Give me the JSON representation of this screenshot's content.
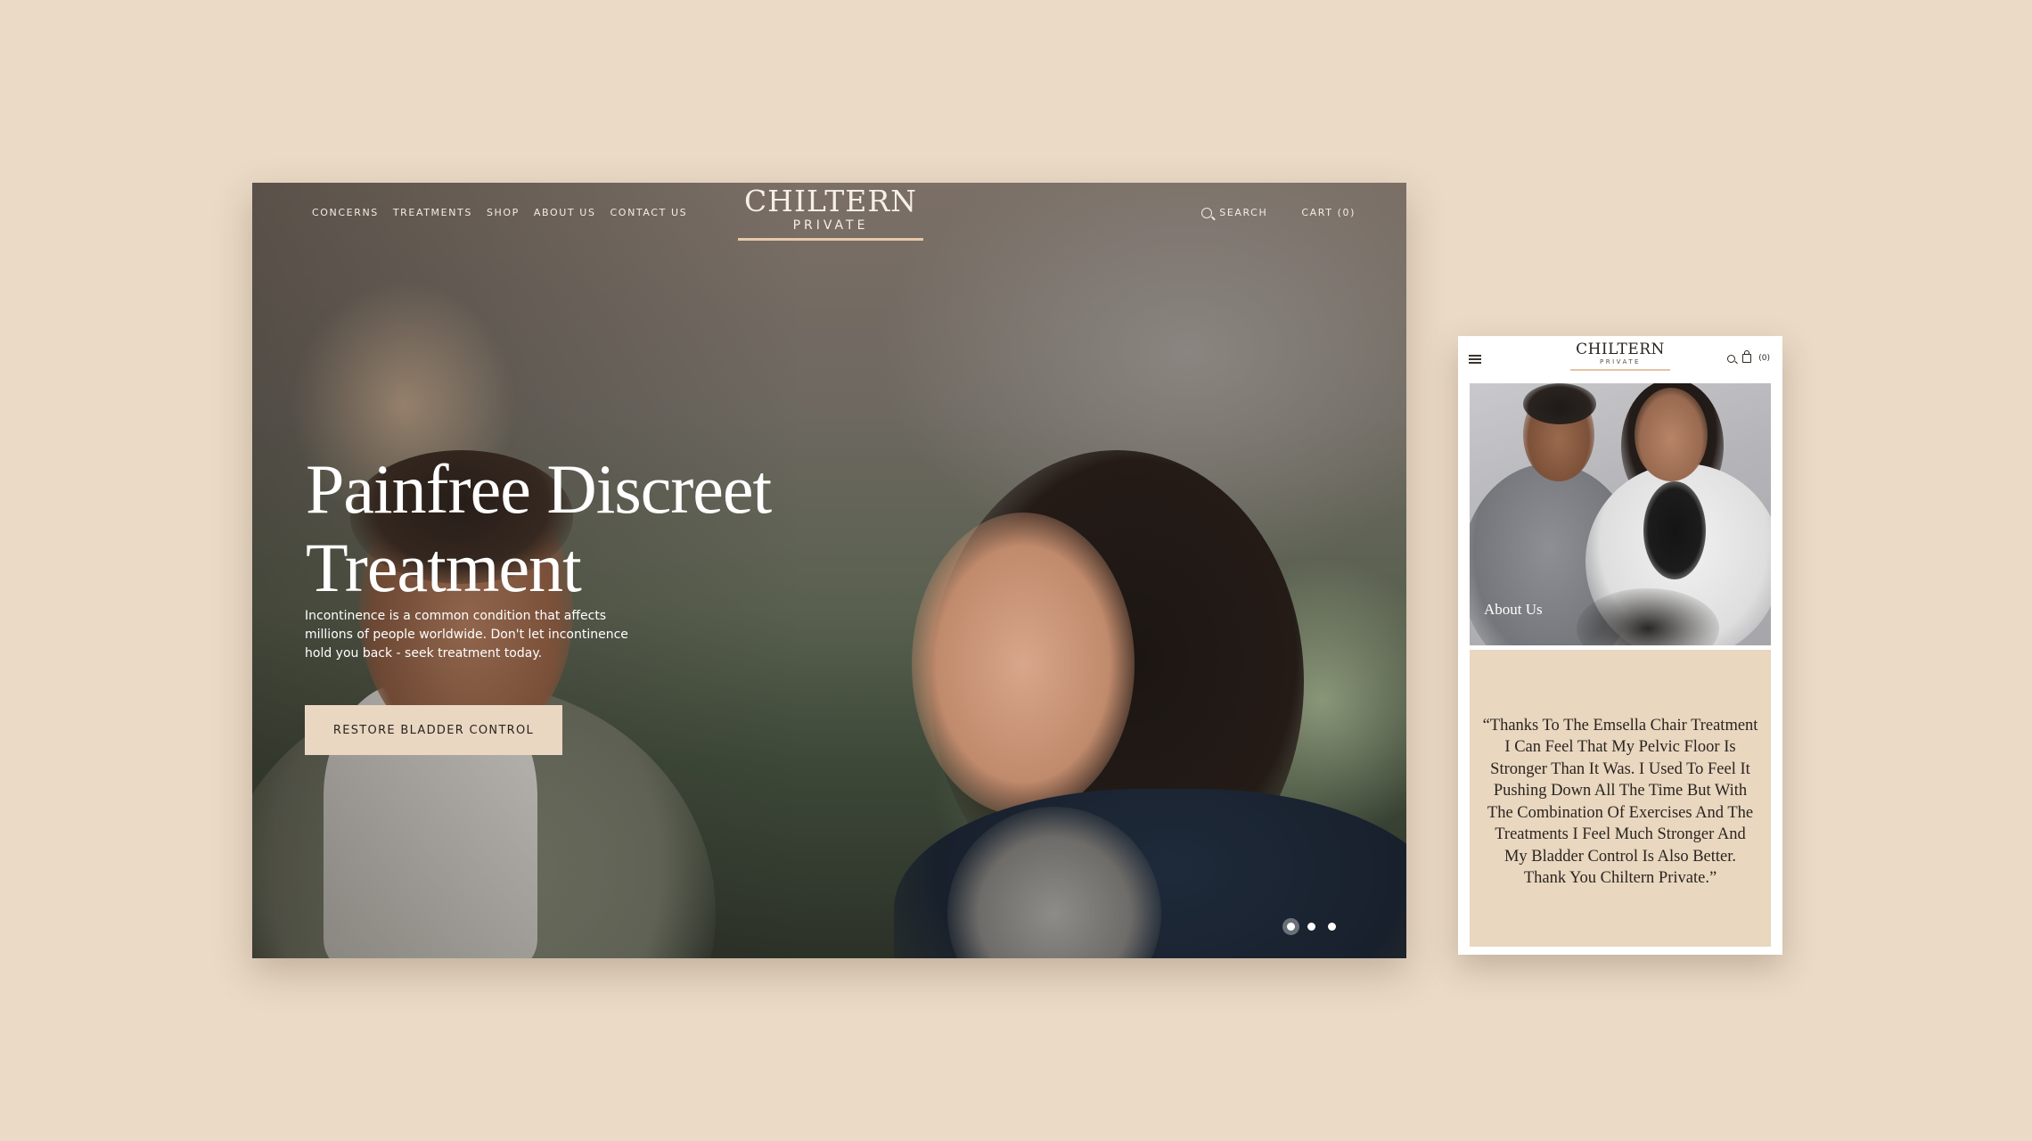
{
  "desktop": {
    "nav": {
      "links": [
        "CONCERNS",
        "TREATMENTS",
        "SHOP",
        "ABOUT US",
        "CONTACT US"
      ],
      "search_label": "SEARCH",
      "cart_label": "CART (0)"
    },
    "logo": {
      "main": "CHILTERN",
      "sub": "PRIVATE"
    },
    "hero": {
      "title": "Painfree Discreet Treatment",
      "text": "Incontinence is a common condition that affects millions of people worldwide. Don't let incontinence hold you back - seek treatment today.",
      "cta_label": "RESTORE BLADDER CONTROL"
    },
    "slider": {
      "count": 3,
      "active_index": 0
    }
  },
  "mobile": {
    "logo": {
      "main": "CHILTERN",
      "sub": "PRIVATE"
    },
    "cart_count": "(0)",
    "photo_caption": "About Us",
    "quote": "“Thanks To The Emsella Chair Treatment I Can Feel That My Pelvic Floor Is Stronger Than It Was. I Used To Feel It Pushing Down All The Time But With The Combination Of Exercises And The Treatments I Feel Much Stronger And My Bladder Control Is Also Better. Thank You Chiltern Private.”"
  },
  "colors": {
    "page_background": "#eadac6",
    "accent_beige": "#ead7c2",
    "logo_rule": "#e6c9a8",
    "dark_text": "#2b2520"
  },
  "icons": [
    "search-icon",
    "cart-icon",
    "menu-icon",
    "bag-icon"
  ]
}
